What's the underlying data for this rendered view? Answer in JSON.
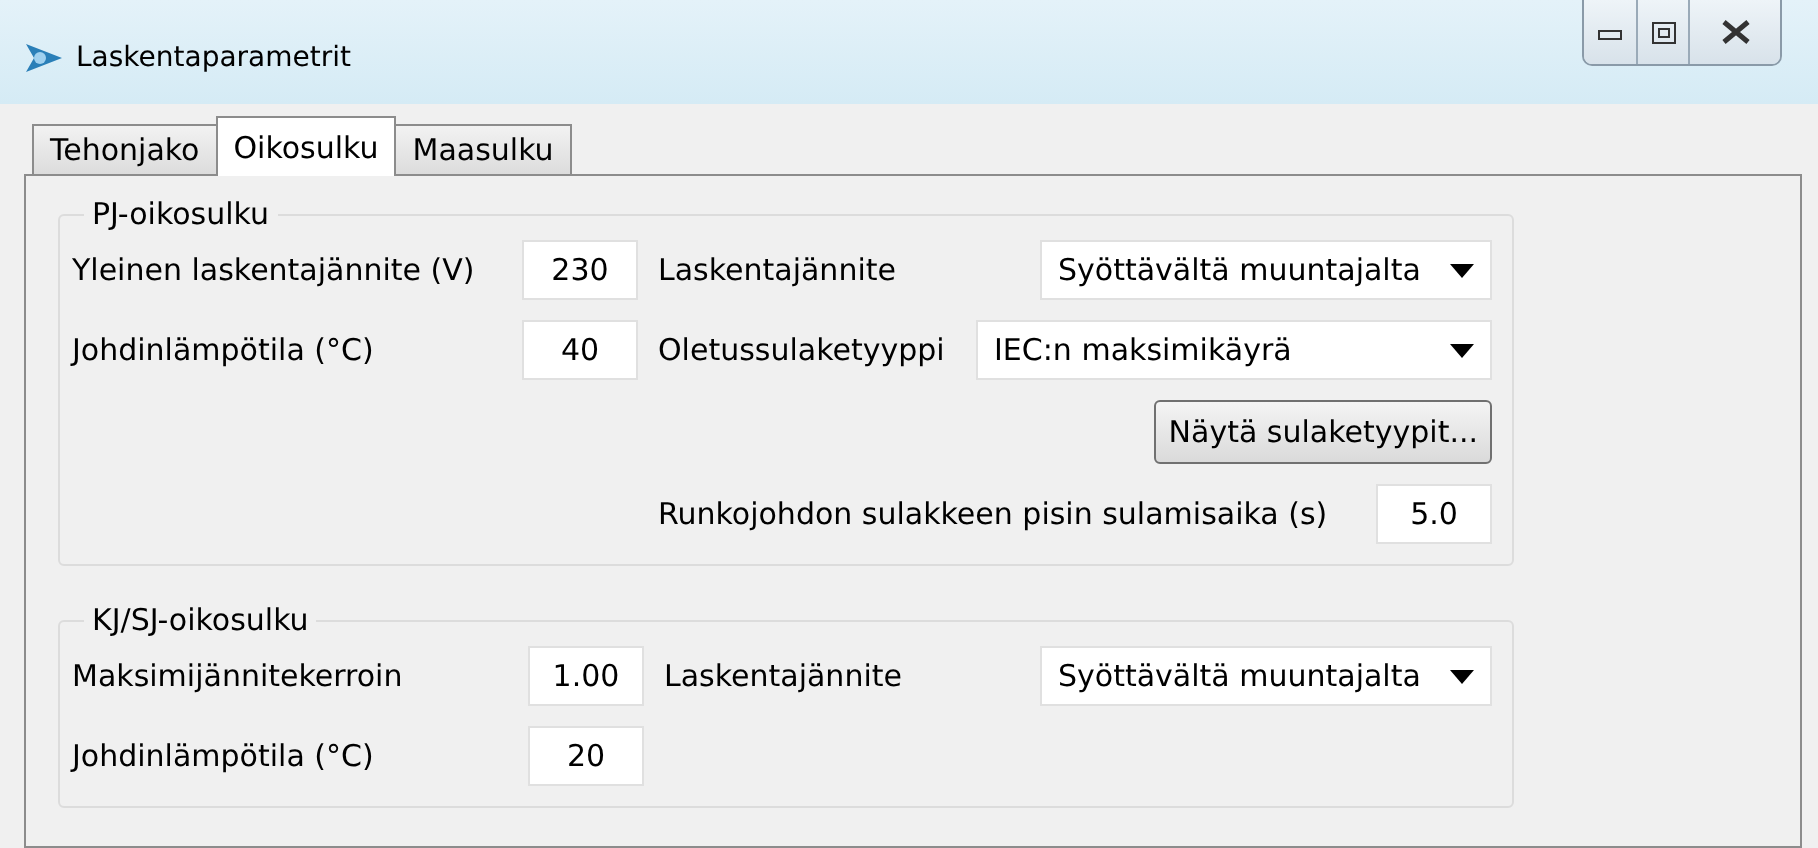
{
  "window": {
    "title": "Laskentaparametrit"
  },
  "tabs": [
    {
      "label": "Tehonjako",
      "selected": false
    },
    {
      "label": "Oikosulku",
      "selected": true
    },
    {
      "label": "Maasulku",
      "selected": false
    }
  ],
  "groups": [
    {
      "title": "PJ-oikosulku",
      "left": [
        {
          "kind": "input",
          "label": "Yleinen laskentajännite (V)",
          "value": "230"
        },
        {
          "kind": "input",
          "label": "Johdinlämpötila (°C)",
          "value": "40"
        }
      ],
      "right": [
        {
          "kind": "dropdown",
          "label": "Laskentajännite",
          "value": "Syöttävältä muuntajalta"
        },
        {
          "kind": "dropdown",
          "label": "Oletussulaketyyppi",
          "value": "IEC:n maksimikäyrä"
        },
        {
          "kind": "button",
          "label": "Näytä sulaketyypit..."
        },
        {
          "kind": "input",
          "label": "Runkojohdon sulakkeen pisin sulamisaika (s)",
          "value": "5.0"
        }
      ]
    },
    {
      "title": "KJ/SJ-oikosulku",
      "left": [
        {
          "kind": "input",
          "label": "Maksimijännitekerroin",
          "value": "1.00"
        },
        {
          "kind": "input",
          "label": "Johdinlämpötila (°C)",
          "value": "20"
        }
      ],
      "right": [
        {
          "kind": "dropdown",
          "label": "Laskentajännite",
          "value": "Syöttävältä muuntajalta"
        }
      ]
    }
  ]
}
